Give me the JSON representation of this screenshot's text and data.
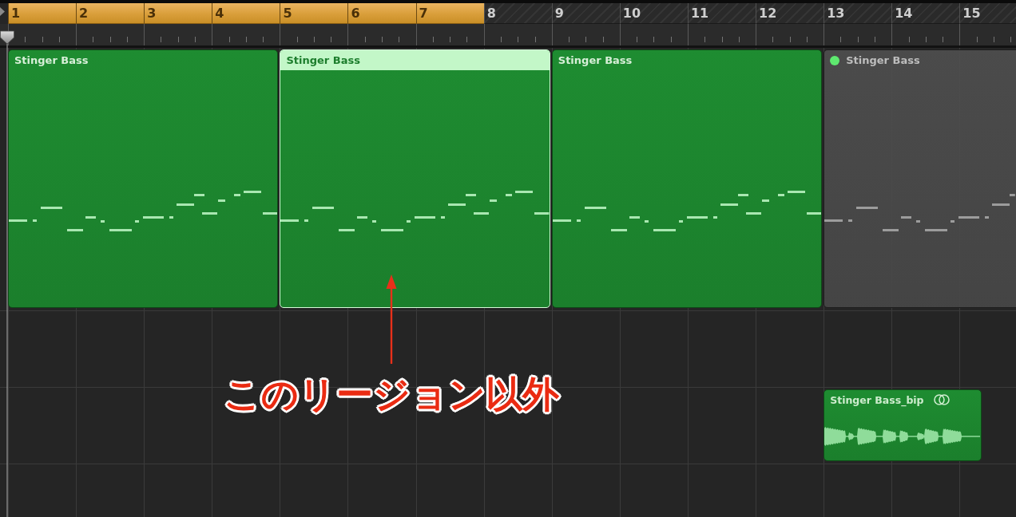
{
  "ruler": {
    "bars": [
      {
        "label": "1",
        "in_cycle": true
      },
      {
        "label": "2",
        "in_cycle": true
      },
      {
        "label": "3",
        "in_cycle": true
      },
      {
        "label": "4",
        "in_cycle": true
      },
      {
        "label": "5",
        "in_cycle": true
      },
      {
        "label": "6",
        "in_cycle": true
      },
      {
        "label": "7",
        "in_cycle": true
      },
      {
        "label": "8",
        "in_cycle": false
      },
      {
        "label": "9",
        "in_cycle": false
      },
      {
        "label": "10",
        "in_cycle": false
      },
      {
        "label": "11",
        "in_cycle": false
      },
      {
        "label": "12",
        "in_cycle": false
      },
      {
        "label": "13",
        "in_cycle": false
      },
      {
        "label": "14",
        "in_cycle": false
      },
      {
        "label": "15",
        "in_cycle": false
      }
    ]
  },
  "tracks": [
    {
      "regions": [
        {
          "kind": "midi",
          "name": "Stinger Bass",
          "selected": false,
          "muted": false
        },
        {
          "kind": "midi",
          "name": "Stinger Bass",
          "selected": true,
          "muted": false
        },
        {
          "kind": "midi",
          "name": "Stinger Bass",
          "selected": false,
          "muted": false
        },
        {
          "kind": "midi",
          "name": "Stinger Bass",
          "selected": false,
          "muted": true
        }
      ]
    },
    {
      "regions": [
        {
          "kind": "audio",
          "name": "Stinger Bass_bip",
          "selected": false,
          "muted": false
        }
      ]
    }
  ],
  "annotation": {
    "text": "このリージョン以外"
  }
}
